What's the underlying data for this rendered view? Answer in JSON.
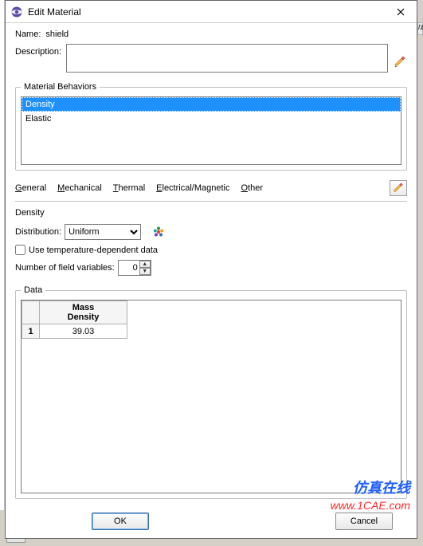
{
  "window": {
    "title": "Edit Material"
  },
  "name": {
    "label": "Name:",
    "value": "shield"
  },
  "description": {
    "label": "Description:",
    "value": ""
  },
  "behaviors": {
    "legend": "Material Behaviors",
    "items": [
      "Density",
      "Elastic"
    ],
    "selected_index": 0
  },
  "menu": {
    "general": "General",
    "mechanical": "Mechanical",
    "thermal": "Thermal",
    "electrical": "Electrical/Magnetic",
    "other": "Other"
  },
  "section": {
    "title": "Density",
    "distribution": {
      "label": "Distribution:",
      "value": "Uniform",
      "options": [
        "Uniform"
      ]
    },
    "use_temp": {
      "label": "Use temperature-dependent data",
      "checked": false
    },
    "num_field_vars": {
      "label": "Number of field variables:",
      "value": "0"
    }
  },
  "data": {
    "legend": "Data",
    "columns": [
      "Mass\nDensity"
    ],
    "rows": [
      {
        "index": "1",
        "values": [
          "39.03"
        ]
      }
    ]
  },
  "buttons": {
    "ok": "OK",
    "cancel": "Cancel"
  },
  "watermark": {
    "line1": "仿真在线",
    "line2": "www.1CAE.com"
  },
  "bg": {
    "tab": "/z"
  }
}
